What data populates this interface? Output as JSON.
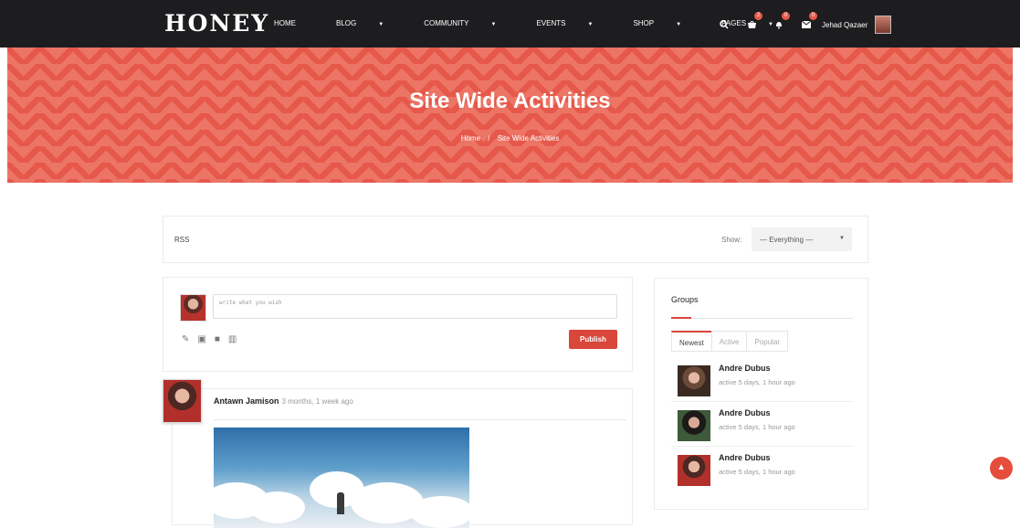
{
  "nav": {
    "logo": "HONEY",
    "items": [
      {
        "label": "HOME",
        "dropdown": false
      },
      {
        "label": "BLOG",
        "dropdown": true
      },
      {
        "label": "COMMUNITY",
        "dropdown": true
      },
      {
        "label": "EVENTS",
        "dropdown": true
      },
      {
        "label": "SHOP",
        "dropdown": true
      },
      {
        "label": "PAGES",
        "dropdown": true
      }
    ],
    "cart_count": "2",
    "notifications_count": "0",
    "messages_count": "0",
    "user_name": "Jehad Qazaer"
  },
  "banner": {
    "title": "Site Wide Activities",
    "breadcrumb_home": "Home",
    "breadcrumb_sep": "/",
    "breadcrumb_current": "Site Wide Activities"
  },
  "filter": {
    "rss_label": "RSS",
    "show_label": "Show:",
    "selected": "— Everything —"
  },
  "composer": {
    "placeholder": "write what you wish",
    "publish_label": "Publish"
  },
  "post": {
    "author": "Antawn Jamison",
    "time": "3 months, 1 week ago"
  },
  "groups": {
    "title": "Groups",
    "tabs": [
      "Newest",
      "Active",
      "Popular"
    ],
    "active_tab": "Newest",
    "items": [
      {
        "name": "Andre Dubus",
        "activity": "active 5 days, 1 hour ago"
      },
      {
        "name": "Andre Dubus",
        "activity": "active 5 days, 1 hour ago"
      },
      {
        "name": "Andre Dubus",
        "activity": "active 5 days, 1 hour ago"
      }
    ]
  },
  "colors": {
    "accent": "#d9463a",
    "nav_bg": "#1d1d1f",
    "banner": "#e6584a"
  },
  "icons": {
    "search": "search-icon",
    "cart": "cart-icon",
    "bell": "bell-icon",
    "mail": "mail-icon",
    "scroll_top": "arrow-up-icon"
  }
}
